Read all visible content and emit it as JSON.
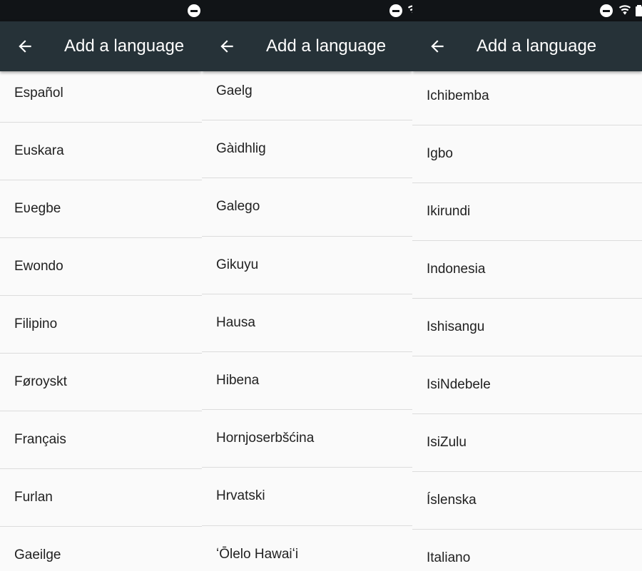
{
  "panels": [
    {
      "title": "Add a language",
      "items": [
        "Español",
        "Euskara",
        "Eʋegbe",
        "Ewondo",
        "Filipino",
        "Føroyskt",
        "Français",
        "Furlan",
        "Gaeilge"
      ]
    },
    {
      "title": "Add a language",
      "items": [
        "Gaelg",
        "Gàidhlig",
        "Galego",
        "Gikuyu",
        "Hausa",
        "Hibena",
        "Hornjoserbšćina",
        "Hrvatski",
        "ʻŌlelo Hawaiʻi"
      ]
    },
    {
      "title": "Add a language",
      "items": [
        "Ichibemba",
        "Igbo",
        "Ikirundi",
        "Indonesia",
        "Ishisangu",
        "IsiNdebele",
        "IsiZulu",
        "Íslenska",
        "Italiano"
      ]
    }
  ],
  "status_icons": [
    "do-not-disturb-icon",
    "wifi-icon",
    "battery-icon"
  ],
  "colors": {
    "status_bar": "#111417",
    "app_bar": "#263238",
    "background": "#fafafa",
    "text": "#212121",
    "divider": "#dcdcdc"
  }
}
